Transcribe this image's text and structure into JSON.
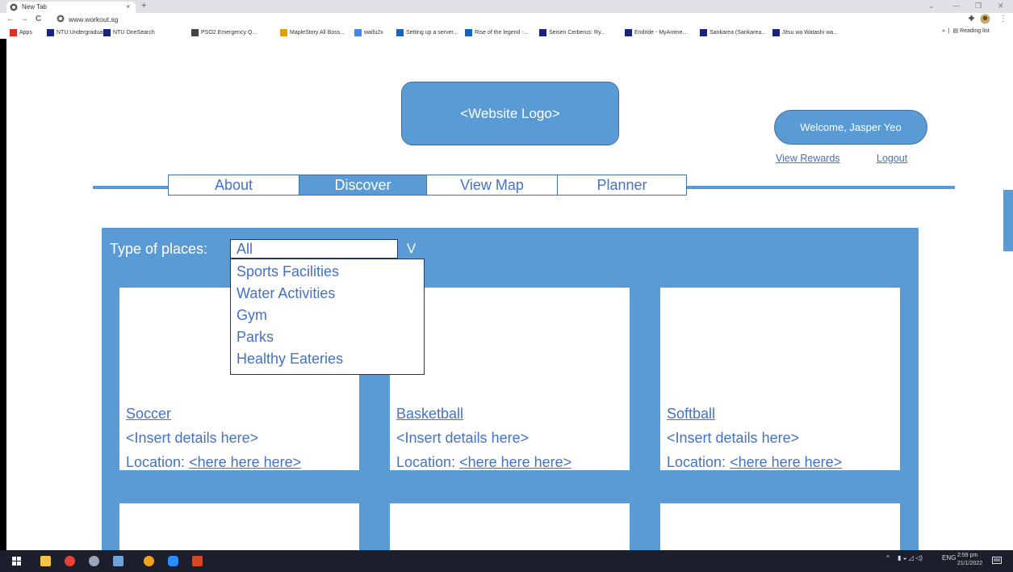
{
  "browser": {
    "tab_title": "New Tab",
    "tab_close": "×",
    "new_tab": "+",
    "url": "www.workout.sg",
    "nav": {
      "back": "←",
      "forward": "→",
      "reload": "C"
    },
    "window_controls": {
      "minimize": "—",
      "restore": "❐",
      "close": "✕",
      "menu": "⌄"
    },
    "bookmarks": [
      {
        "label": "Apps",
        "color": "#d93025"
      },
      {
        "label": "NTU:Undergraduat...",
        "color": "#1a237e"
      },
      {
        "label": "NTU OneSearch",
        "color": "#1a237e"
      },
      {
        "label": "PSO2 Emergency Q...",
        "color": "#444444"
      },
      {
        "label": "MapleStory All Boss...",
        "color": "#e0a000"
      },
      {
        "label": "waifu2x",
        "color": "#4285f4"
      },
      {
        "label": "Setting up a server...",
        "color": "#1565c0"
      },
      {
        "label": "Rise of the legend -...",
        "color": "#1565c0"
      },
      {
        "label": "Seisen Cerberus: Ry...",
        "color": "#1a237e"
      },
      {
        "label": "Endride - MyAnime...",
        "color": "#1a237e"
      },
      {
        "label": "Sankarea (Sankarea...",
        "color": "#1a237e"
      },
      {
        "label": "Jitsu wa Watashi wa...",
        "color": "#1a237e"
      }
    ],
    "more_bookmarks": "»",
    "reading_list": "Reading list"
  },
  "header": {
    "logo_text": "<Website Logo>",
    "welcome": "Welcome, Jasper Yeo",
    "view_rewards": "View Rewards",
    "logout": "Logout"
  },
  "nav": {
    "items": [
      {
        "label": "About",
        "active": false
      },
      {
        "label": "Discover",
        "active": true
      },
      {
        "label": "View Map",
        "active": false
      },
      {
        "label": "Planner",
        "active": false
      }
    ]
  },
  "filter": {
    "label": "Type of places:",
    "selected": "All",
    "arrow": "V",
    "options": [
      "Sports Facilities",
      "Water Activities",
      "Gym",
      "Parks",
      "Healthy Eateries"
    ]
  },
  "cards": [
    {
      "title": "Soccer",
      "details": "<Insert details here>",
      "location_label": "Location: ",
      "location_link": "<here here here>"
    },
    {
      "title": "Basketball",
      "details": "<Insert details here>",
      "location_label": "Location: ",
      "location_link": "<here here here>"
    },
    {
      "title": "Softball",
      "details": "<Insert details here>",
      "location_label": "Location: ",
      "location_link": "<here here here>"
    }
  ],
  "taskbar": {
    "lang": "ENG",
    "time": "2:59 pm",
    "date": "21/1/2022",
    "tray_up": "^"
  },
  "colors": {
    "accent": "#5b9bd5",
    "link": "#4472c4",
    "border": "#41719c"
  }
}
